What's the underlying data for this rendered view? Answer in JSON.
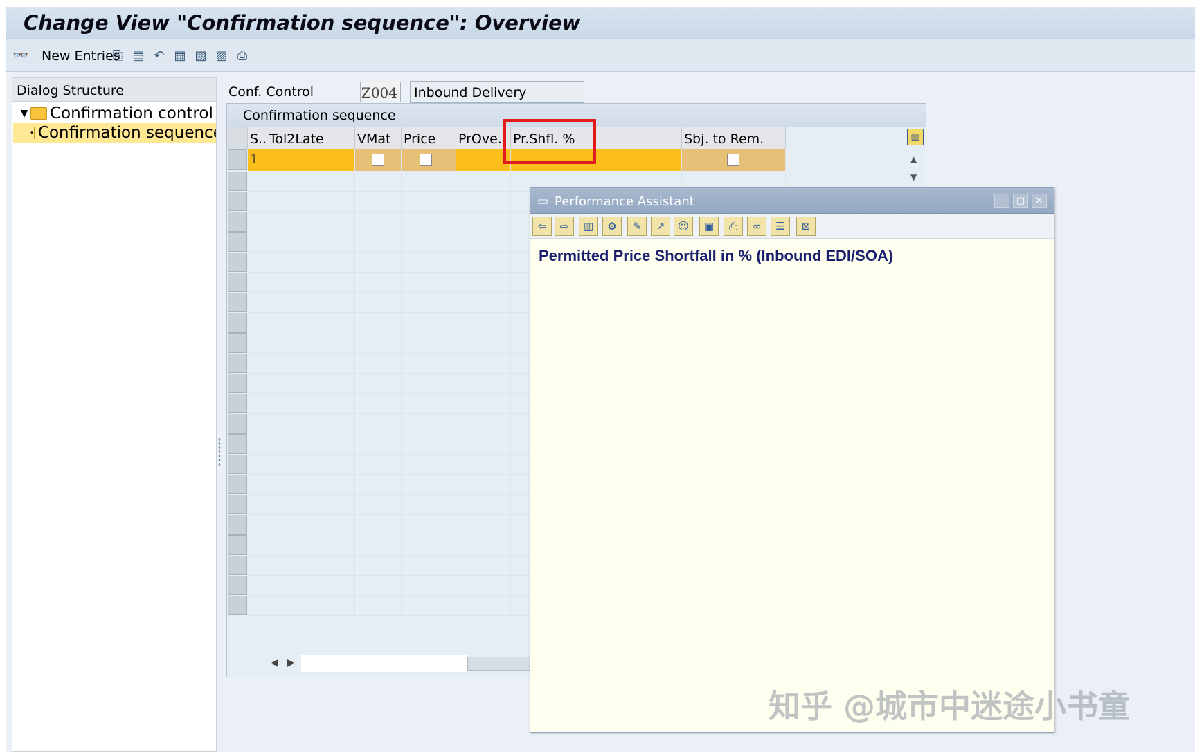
{
  "window": {
    "title": "Change View \"Confirmation sequence\": Overview"
  },
  "toolbar": {
    "new_entries_label": "New Entries",
    "icons": [
      "glasses-icon",
      "copy-icon",
      "delete-icon",
      "undo-icon",
      "select-all-icon",
      "select-block-icon",
      "deselect-icon",
      "print-icon"
    ]
  },
  "dialog_structure": {
    "header": "Dialog Structure",
    "items": [
      {
        "label": "Confirmation control key",
        "level": 0,
        "selected": false
      },
      {
        "label": "Confirmation sequence",
        "level": 1,
        "selected": true
      }
    ]
  },
  "conf_control": {
    "label": "Conf. Control",
    "code": "Z004",
    "description": "Inbound Delivery"
  },
  "table": {
    "title": "Confirmation sequence",
    "columns": [
      "S..",
      "Tol2Late",
      "VMat",
      "Price",
      "PrOve..",
      "Pr.Shfl. %",
      "Sbj. to Rem."
    ],
    "rows": [
      {
        "seq": "1",
        "tol2late": "",
        "vmat": false,
        "price": false,
        "prove": "",
        "prshfl": "",
        "sbj_to_rem": false
      }
    ],
    "highlighted_column": "Pr.Shfl. %"
  },
  "performance_assistant": {
    "title": "Performance Assistant",
    "heading": "Permitted Price Shortfall in % (Inbound EDI/SOA)",
    "controls": [
      "minimize-icon",
      "maximize-icon",
      "close-icon"
    ]
  },
  "watermark": {
    "text": "知乎 @城市中迷途小书童"
  },
  "colors": {
    "row_highlight": "#fbbe1a",
    "selected_tree_item": "#ffe893",
    "highlight_box": "#e21a1a",
    "pa_heading": "#1a1f6e"
  }
}
